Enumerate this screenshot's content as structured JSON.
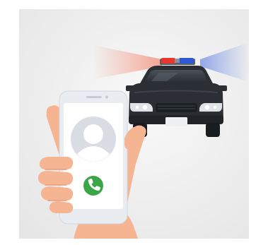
{
  "scene": {
    "icons": {
      "police_car": "police-car-icon",
      "phone": "smartphone-icon",
      "avatar": "user-avatar-icon",
      "call": "phone-call-icon",
      "hand": "hand-icon",
      "siren": "siren-light-icon"
    },
    "colors": {
      "panel_background": "#ededed",
      "car_body": "#2b2f33",
      "siren_red": "#e8372f",
      "siren_blue": "#2f58d6",
      "beam_red": "#f3a090",
      "beam_blue": "#8ea2e6",
      "phone_body": "#e9ecf1",
      "phone_screen": "#ffffff",
      "avatar": "#d9dde3",
      "call_button": "#3aa648",
      "skin": "#f6b592",
      "skin_shadow": "#ea9a7a"
    }
  }
}
